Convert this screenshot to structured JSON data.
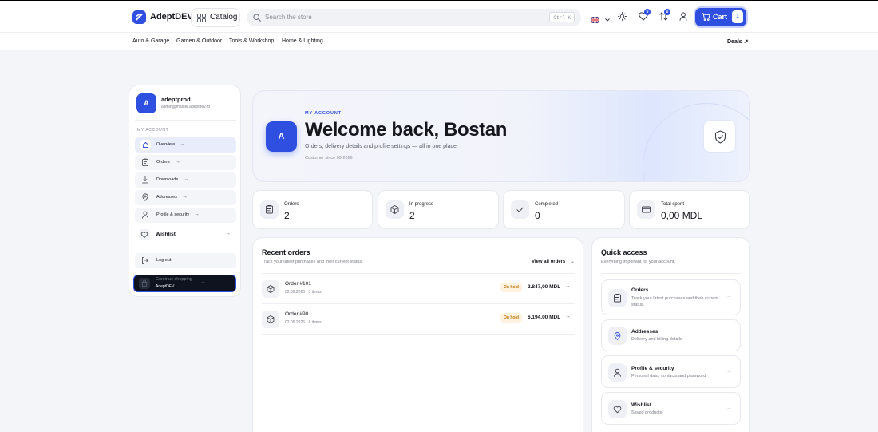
{
  "brand": {
    "name": "AdeptDEV",
    "accent": "#2f4fe0"
  },
  "header": {
    "catalog_label": "Catalog",
    "search_placeholder": "Search the store",
    "search_shortcut": "Ctrl K",
    "wishlist_count": "0",
    "compare_count": "0",
    "cart_label": "Cart",
    "cart_count": "1"
  },
  "categories": [
    "Auto & Garage",
    "Garden & Outdoor",
    "Tools & Workshop",
    "Home & Lighting"
  ],
  "deals_label": "Deals ↗",
  "sidebar": {
    "avatar_letter": "A",
    "username": "adeptprod",
    "email": "admin@master.adeptdev.ro",
    "section_label": "MY ACCOUNT",
    "items": [
      "Overview",
      "Orders",
      "Downloads",
      "Addresses",
      "Profile & security",
      "Wishlist"
    ],
    "logout_label": "Log out",
    "continue_label": "Continue shopping",
    "continue_sub": "AdeptDEV"
  },
  "hero": {
    "eyebrow": "MY ACCOUNT",
    "title": "Welcome back, Bostan",
    "subtitle": "Orders, delivery details and profile settings — all in one place.",
    "since": "Customer since 09.2026",
    "avatar_letter": "A"
  },
  "stats": [
    {
      "label": "Orders",
      "value": "2"
    },
    {
      "label": "In progress",
      "value": "2"
    },
    {
      "label": "Completed",
      "value": "0"
    },
    {
      "label": "Total spent",
      "value": "0,00 MDL"
    }
  ],
  "recent_orders": {
    "title": "Recent orders",
    "subtitle": "Track your latest purchases and their current status.",
    "view_all": "View all orders",
    "rows": [
      {
        "id": "Order #101",
        "meta": "02.09.2026 · 3 items",
        "status": "On hold",
        "total": "2.847,00 MDL"
      },
      {
        "id": "Order #90",
        "meta": "02.09.2026 · 6 items",
        "status": "On hold",
        "total": "6.194,00 MDL"
      }
    ]
  },
  "quick_access": {
    "title": "Quick access",
    "subtitle": "Everything important for your account.",
    "items": [
      {
        "title": "Orders",
        "desc": "Track your latest purchases and their current status."
      },
      {
        "title": "Addresses",
        "desc": "Delivery and billing details"
      },
      {
        "title": "Profile & security",
        "desc": "Personal data, contacts and password"
      },
      {
        "title": "Wishlist",
        "desc": "Saved products"
      }
    ]
  }
}
